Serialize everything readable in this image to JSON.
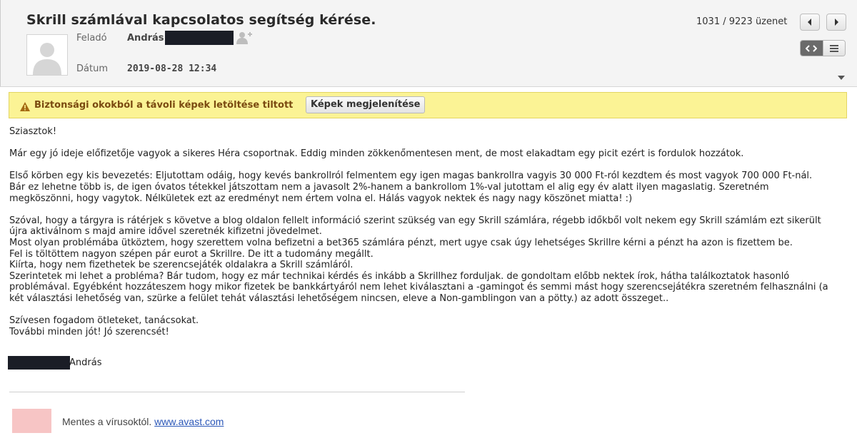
{
  "message": {
    "subject": "Skrill számlával kapcsolatos segítség kérése.",
    "from_label": "Feladó",
    "from_name": "András",
    "date_label": "Dátum",
    "date_value": "2019-08-28 12:34"
  },
  "navigation": {
    "counter": "1031 / 9223 üzenet",
    "prev_icon": "chevron-left-icon",
    "next_icon": "chevron-right-icon"
  },
  "view_toggle": {
    "html_icon": "code-icon",
    "plain_icon": "text-lines-icon",
    "active": "html"
  },
  "warning": {
    "text": "Biztonsági okokból a távoli képek letöltése tiltott",
    "button_label": "Képek megjelenítése",
    "icon": "warning-icon",
    "color": "#fbf395"
  },
  "body": {
    "lines": [
      "Sziasztok!",
      "",
      "Már egy jó ideje előfizetője vagyok a sikeres Héra csoportnak. Eddig minden zökkenőmentesen ment, de most elakadtam egy picit ezért is fordulok hozzátok.",
      "",
      "Első körben egy kis bevezetés: Eljutottam odáig, hogy kevés bankrollról felmentem egy igen magas bankrollra vagyis 30 000 Ft-ról kezdtem és most vagyok 700 000 Ft-nál.",
      "Bár ez lehetne több is, de igen óvatos tétekkel játszottam nem a javasolt 2%-hanem a bankrollom 1%-val jutottam el alig egy év alatt ilyen magaslatig. Szeretném",
      "megköszönni, hogy vagytok. Nélkületek ezt az eredményt nem értem volna el. Hálás vagyok nektek és nagy nagy köszönet miatta! :)",
      "",
      "Szóval, hogy a tárgyra is rátérjek s követve a blog oldalon fellelt információ szerint szükség van egy Skrill számlára, régebb időkből volt nekem egy Skrill számlám ezt sikerült",
      "újra aktiválnom s majd  amire idővel szeretnék kifizetni jövedelmet.",
      "Most olyan problémába ütköztem, hogy szerettem volna befizetni a bet365 számlára pénzt, mert ugye csak úgy lehetséges Skrillre kérni a pénzt ha azon is fizettem be.",
      "Fel is töltöttem nagyon szépen pár eurot a Skrillre. De itt a tudomány megállt.",
      "Kiírta, hogy nem fizethetek be szerencsejáték oldalakra a Skrill számláról.",
      "Szerintetek mi lehet a probléma? Bár tudom, hogy ez már technikai kérdés és inkább a Skrillhez forduljak. de gondoltam előbb nektek írok, hátha találkoztatok hasonló",
      "problémával. Egyébként hozzáteszem hogy mikor fizetek be bankkártyáról nem lehet kiválasztani a -gamingot és semmi mást hogy szerencsejátékra szeretném felhasználni (a",
      "két választási lehetőség van, szürke a felület tehát választási lehetőségem nincsen, eleve a Non-gamblingon van a pötty.) az adott összeget..",
      "",
      "Szívesen fogadom ötleteket, tanácsokat.",
      "További minden jót! Jó szerencsét!"
    ],
    "signature_name": "András"
  },
  "footer": {
    "avast_text": "Mentes a vírusoktól.",
    "avast_link": "www.avast.com"
  }
}
